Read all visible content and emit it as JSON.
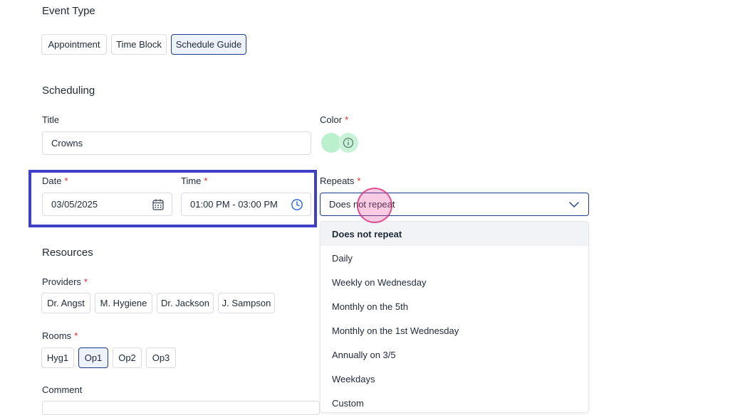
{
  "event_type": {
    "heading": "Event Type",
    "options": [
      {
        "label": "Appointment",
        "selected": false
      },
      {
        "label": "Time Block",
        "selected": false
      },
      {
        "label": "Schedule Guide",
        "selected": true
      }
    ]
  },
  "scheduling": {
    "heading": "Scheduling",
    "title_label": "Title",
    "title_value": "Crowns",
    "color_label": "Color",
    "color_swatch": "#bbf0cf",
    "date_label": "Date",
    "date_value": "03/05/2025",
    "time_label": "Time",
    "time_value": "01:00 PM - 03:00 PM",
    "repeats_label": "Repeats",
    "repeats_value": "Does not repeat",
    "required_mark": "*"
  },
  "repeat_options": [
    {
      "label": "Does not repeat",
      "selected": true
    },
    {
      "label": "Daily",
      "selected": false
    },
    {
      "label": "Weekly on Wednesday",
      "selected": false
    },
    {
      "label": "Monthly on the 5th",
      "selected": false
    },
    {
      "label": "Monthly on the 1st Wednesday",
      "selected": false
    },
    {
      "label": "Annually on 3/5",
      "selected": false
    },
    {
      "label": "Weekdays",
      "selected": false
    },
    {
      "label": "Custom",
      "selected": false
    }
  ],
  "resources": {
    "heading": "Resources",
    "providers_label": "Providers",
    "providers": [
      {
        "label": "Dr. Angst",
        "selected": false
      },
      {
        "label": "M. Hygiene",
        "selected": false
      },
      {
        "label": "Dr. Jackson",
        "selected": false
      },
      {
        "label": "J. Sampson",
        "selected": false
      }
    ],
    "rooms_label": "Rooms",
    "rooms": [
      {
        "label": "Hyg1",
        "selected": false
      },
      {
        "label": "Op1",
        "selected": true
      },
      {
        "label": "Op2",
        "selected": false
      },
      {
        "label": "Op3",
        "selected": false
      }
    ],
    "comment_label": "Comment"
  },
  "colors": {
    "accent": "#1e3a8a",
    "highlight_box": "#3f3fc9",
    "required": "#dc2626",
    "click_marker": "#e0468f"
  },
  "icons": {
    "date": "calendar-icon",
    "time": "clock-icon",
    "info": "info-icon",
    "dropdown": "chevron-down-icon"
  }
}
